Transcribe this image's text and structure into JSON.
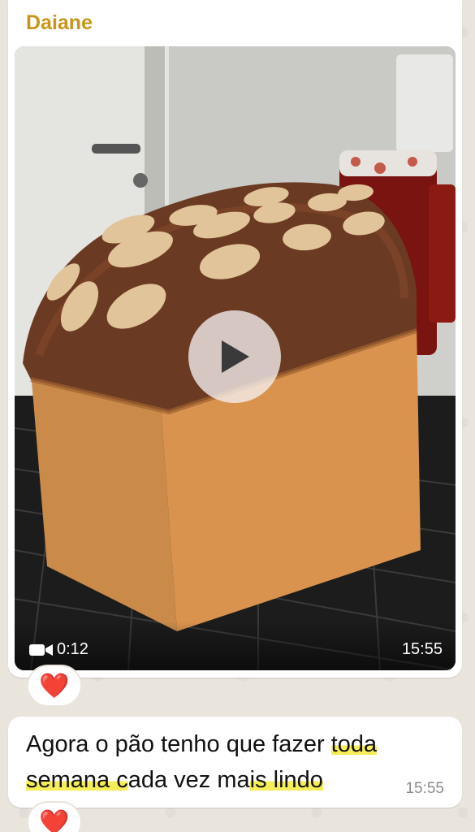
{
  "chat": {
    "messages": [
      {
        "sender": "Daiane",
        "type": "video",
        "duration": "0:12",
        "time": "15:55",
        "reaction": "❤️"
      },
      {
        "type": "text",
        "line1_a": "Agora o pão tenho que fazer ",
        "line1_b": "toda",
        "line2_a": "semana c",
        "line2_b": "ada vez ma",
        "line2_c": "is lindo",
        "time": "15:55",
        "reaction": "❤️"
      }
    ]
  },
  "colors": {
    "sender_name": "#c8951b",
    "highlight": "#f5ee5a",
    "reaction_heart": "#e0242b",
    "chat_background": "#e9e4dc"
  },
  "icons": {
    "video_indicator": "video-camera-icon",
    "play": "play-icon",
    "reaction": "heart-icon"
  }
}
